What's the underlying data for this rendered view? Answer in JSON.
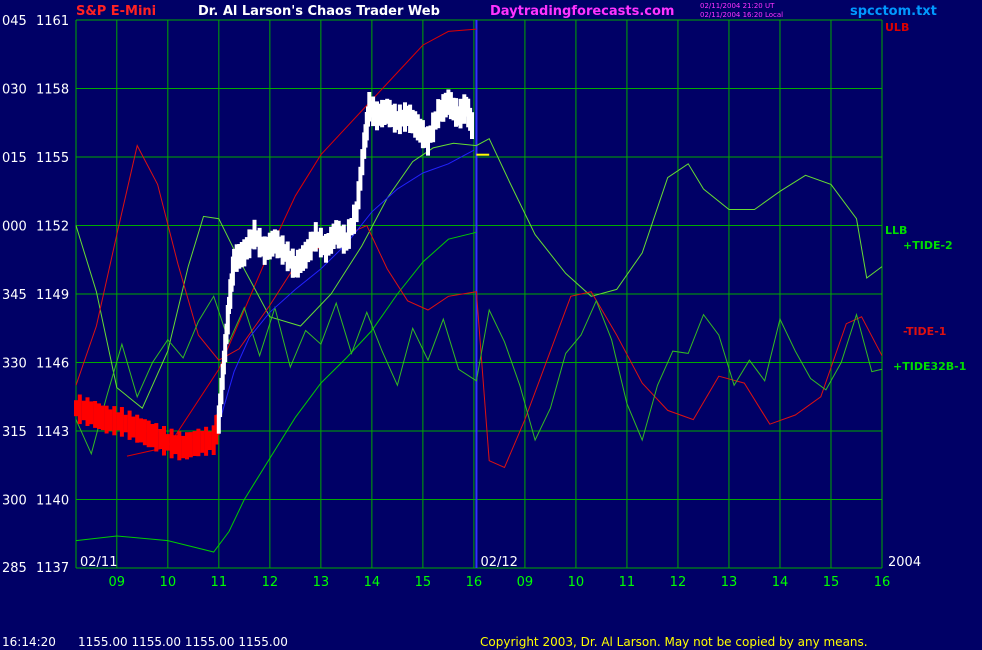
{
  "header": {
    "symbol": "S&P E-Mini",
    "title": "Dr. Al Larson's Chaos Trader Web",
    "site": "Daytradingforecasts.com",
    "stamp1": "02/11/2004 21:20 UT",
    "stamp2": "02/11/2004 16:20 Local",
    "file": "spcctom.txt"
  },
  "footer": {
    "time": "16:14:20",
    "quote": "1155.00 1155.00 1155.00 1155.00",
    "copyright": "Copyright 2003, Dr. Al Larson. May not be copied by any means."
  },
  "colors": {
    "background": "#000066",
    "grid": "#00aa00",
    "price": "#ffffff",
    "price_early": "#ff0000",
    "ulb": "#dd0000",
    "llb": "#00cc00",
    "tide2": "#66dd33",
    "tide1": "#dd1111",
    "tide32b": "#33bb22",
    "avg_blue": "#2222ff",
    "avg_yellow": "#ffff00",
    "divider": "#3333ff",
    "axis_text": "#ffffff",
    "time_text": "#00ff00",
    "site_text": "#ff33ff",
    "file_text": "#0099ff"
  },
  "chart_data": {
    "type": "line",
    "y_axis": {
      "range": [
        1137,
        1161
      ],
      "ticks": [
        {
          "code": "045",
          "price": "1161",
          "value": 1161
        },
        {
          "code": "030",
          "price": "1158",
          "value": 1158
        },
        {
          "code": "015",
          "price": "1155",
          "value": 1155
        },
        {
          "code": "000",
          "price": "1152",
          "value": 1152
        },
        {
          "code": "345",
          "price": "1149",
          "value": 1149
        },
        {
          "code": "330",
          "price": "1146",
          "value": 1146
        },
        {
          "code": "315",
          "price": "1143",
          "value": 1143
        },
        {
          "code": "300",
          "price": "1140",
          "value": 1140
        },
        {
          "code": "285",
          "price": "1137",
          "value": 1137
        }
      ]
    },
    "x_axis": {
      "range": [
        8.2,
        24
      ],
      "ticks": [
        {
          "label": "09",
          "x": 9
        },
        {
          "label": "10",
          "x": 10
        },
        {
          "label": "11",
          "x": 11
        },
        {
          "label": "12",
          "x": 12
        },
        {
          "label": "13",
          "x": 13
        },
        {
          "label": "14",
          "x": 14
        },
        {
          "label": "15",
          "x": 15
        },
        {
          "label": "16",
          "x": 16
        },
        {
          "label": "09",
          "x": 17
        },
        {
          "label": "10",
          "x": 18
        },
        {
          "label": "11",
          "x": 19
        },
        {
          "label": "12",
          "x": 20
        },
        {
          "label": "13",
          "x": 21
        },
        {
          "label": "14",
          "x": 22
        },
        {
          "label": "15",
          "x": 23
        },
        {
          "label": "16",
          "x": 24
        }
      ],
      "day_labels": [
        {
          "label": "02/11",
          "x": 8.2
        },
        {
          "label": "02/12",
          "x": 16.05
        },
        {
          "label": "2004",
          "x": 24
        }
      ],
      "divider_x": 16.05
    },
    "grid": true,
    "series": [
      {
        "name": "ULB",
        "color": "ulb",
        "x": [
          9.2,
          10,
          11,
          11.5,
          12,
          12.5,
          13,
          13.5,
          14,
          14.5,
          15,
          15.5,
          16.05
        ],
        "y": [
          1141.9,
          1142.3,
          1145.7,
          1148.3,
          1150.9,
          1153.3,
          1155.1,
          1156.3,
          1157.5,
          1158.7,
          1159.9,
          1160.5,
          1160.6
        ]
      },
      {
        "name": "LLB",
        "color": "llb",
        "x": [
          8.2,
          9,
          10,
          10.9,
          11.2,
          11.5,
          12,
          12.5,
          13,
          13.5,
          14,
          14.5,
          15,
          15.5,
          16.05
        ],
        "y": [
          1138.2,
          1138.4,
          1138.2,
          1137.7,
          1138.6,
          1140.0,
          1141.8,
          1143.6,
          1145.1,
          1146.2,
          1147.4,
          1149.0,
          1150.4,
          1151.4,
          1151.7
        ]
      },
      {
        "name": "+TIDE-2",
        "color": "tide2",
        "x": [
          8.2,
          8.6,
          9,
          9.5,
          10,
          10.4,
          10.7,
          11,
          11.4,
          12,
          12.6,
          13.2,
          13.8,
          14.3,
          14.8,
          15.2,
          15.6,
          16.05,
          16.3,
          16.7,
          17.2,
          17.8,
          18.3,
          18.8,
          19.3,
          19.8,
          20.2,
          20.5,
          21,
          21.5,
          22,
          22.5,
          23,
          23.5,
          23.7,
          24
        ],
        "y": [
          1152.0,
          1149.1,
          1144.9,
          1144.0,
          1146.5,
          1150.2,
          1152.4,
          1152.3,
          1150.5,
          1148.0,
          1147.6,
          1149.0,
          1151.1,
          1153.2,
          1154.8,
          1155.4,
          1155.6,
          1155.5,
          1155.8,
          1153.9,
          1151.6,
          1149.9,
          1148.9,
          1149.2,
          1150.8,
          1154.1,
          1154.7,
          1153.6,
          1152.7,
          1152.7,
          1153.5,
          1154.2,
          1153.8,
          1152.3,
          1149.7,
          1150.2
        ]
      },
      {
        "name": "-TIDE-1",
        "color": "tide1",
        "x": [
          8.2,
          8.6,
          9,
          9.4,
          9.8,
          10.2,
          10.6,
          11,
          11.4,
          12,
          12.6,
          13.3,
          13.9,
          14.3,
          14.7,
          15.1,
          15.5,
          16.05,
          16.3,
          16.6,
          17,
          17.5,
          17.9,
          18.3,
          18.8,
          19.3,
          19.8,
          20.3,
          20.8,
          21.3,
          21.8,
          22.3,
          22.8,
          23.3,
          23.6,
          24
        ],
        "y": [
          1145.0,
          1147.6,
          1151.6,
          1155.5,
          1153.8,
          1150.3,
          1147.2,
          1146.1,
          1146.6,
          1148.5,
          1150.6,
          1151.4,
          1152.0,
          1150.1,
          1148.7,
          1148.3,
          1148.9,
          1149.1,
          1141.7,
          1141.4,
          1143.5,
          1146.5,
          1148.9,
          1149.1,
          1147.2,
          1145.1,
          1143.9,
          1143.5,
          1145.4,
          1145.1,
          1143.3,
          1143.7,
          1144.5,
          1147.7,
          1148.0,
          1146.3
        ]
      },
      {
        "name": "+TIDE32B-1",
        "color": "tide32b",
        "x": [
          8.2,
          8.5,
          8.8,
          9.1,
          9.4,
          9.7,
          10,
          10.3,
          10.6,
          10.9,
          11.2,
          11.5,
          11.8,
          12.1,
          12.4,
          12.7,
          13,
          13.3,
          13.6,
          13.9,
          14.2,
          14.5,
          14.8,
          15.1,
          15.4,
          15.7,
          16.05,
          16.3,
          16.6,
          16.9,
          17.2,
          17.5,
          17.8,
          18.1,
          18.4,
          18.7,
          19,
          19.3,
          19.6,
          19.9,
          20.2,
          20.5,
          20.8,
          21.1,
          21.4,
          21.7,
          22,
          22.3,
          22.6,
          22.9,
          23.2,
          23.5,
          23.8,
          24
        ],
        "y": [
          1143.5,
          1142.0,
          1144.5,
          1146.8,
          1144.5,
          1146.0,
          1147.0,
          1146.2,
          1147.8,
          1148.9,
          1146.9,
          1148.4,
          1146.3,
          1148.4,
          1145.8,
          1147.4,
          1146.8,
          1148.6,
          1146.4,
          1148.2,
          1146.5,
          1145.0,
          1147.5,
          1146.1,
          1147.9,
          1145.7,
          1145.2,
          1148.3,
          1146.9,
          1145.0,
          1142.6,
          1144.0,
          1146.4,
          1147.2,
          1148.7,
          1147.0,
          1144.2,
          1142.6,
          1145.0,
          1146.5,
          1146.4,
          1148.1,
          1147.2,
          1145.0,
          1146.1,
          1145.2,
          1147.9,
          1146.5,
          1145.3,
          1144.8,
          1146.0,
          1148.1,
          1145.6,
          1145.7
        ]
      },
      {
        "name": "",
        "color": "avg_blue",
        "x": [
          11,
          11.3,
          11.6,
          12,
          12.5,
          13,
          13.5,
          14,
          14.5,
          15,
          15.5,
          16
        ],
        "y": [
          1143.3,
          1145.6,
          1147.1,
          1148.2,
          1149.2,
          1150.1,
          1151.2,
          1152.6,
          1153.6,
          1154.3,
          1154.7,
          1155.3
        ]
      },
      {
        "name": "",
        "color": "avg_yellow",
        "x": [
          16.05,
          16.3
        ],
        "y": [
          1155.1,
          1155.1
        ]
      }
    ],
    "price_path": {
      "x": [
        8.2,
        8.5,
        8.8,
        9.1,
        9.4,
        9.7,
        10,
        10.3,
        10.6,
        10.9,
        11,
        11.1,
        11.2,
        11.3,
        11.5,
        11.7,
        11.9,
        12.1,
        12.3,
        12.5,
        12.7,
        12.9,
        13.1,
        13.3,
        13.5,
        13.7,
        13.85,
        13.95,
        14.1,
        14.3,
        14.5,
        14.7,
        14.9,
        15.1,
        15.3,
        15.5,
        15.7,
        15.85,
        16
      ],
      "y": [
        1144.0,
        1143.8,
        1143.5,
        1143.4,
        1143.1,
        1142.8,
        1142.5,
        1142.3,
        1142.5,
        1142.6,
        1143.5,
        1146.0,
        1148.5,
        1150.5,
        1150.8,
        1151.6,
        1150.9,
        1151.3,
        1150.8,
        1150.2,
        1150.7,
        1151.5,
        1151.0,
        1151.7,
        1151.3,
        1152.6,
        1155.5,
        1157.2,
        1156.8,
        1157.0,
        1156.6,
        1156.8,
        1156.3,
        1155.7,
        1156.9,
        1157.4,
        1156.8,
        1157.2,
        1156.1
      ],
      "early_until": 11.0
    }
  }
}
